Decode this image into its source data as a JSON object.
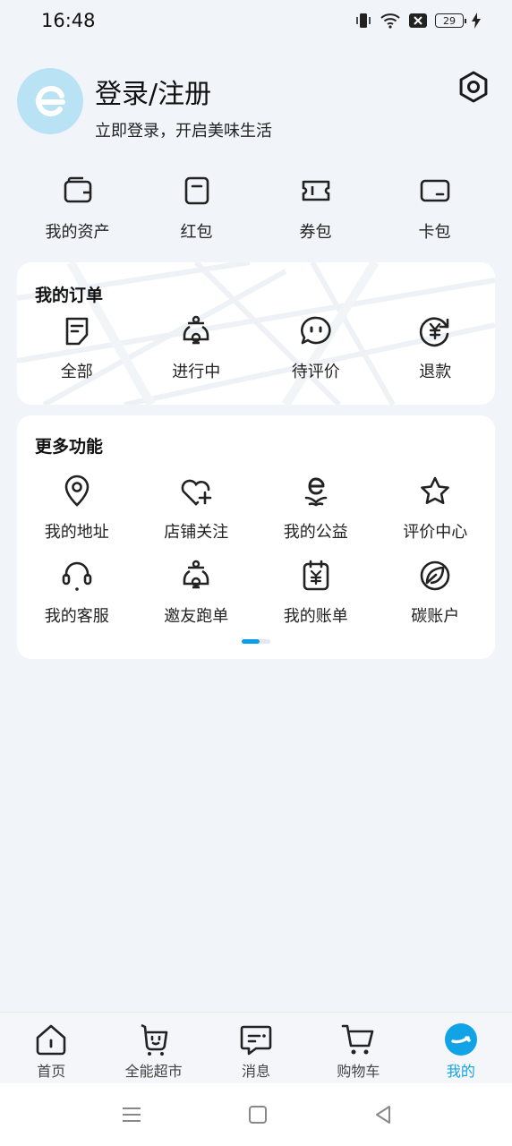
{
  "status_bar": {
    "time": "16:48",
    "battery": "29"
  },
  "header": {
    "title": "登录/注册",
    "subtitle": "立即登录，开启美味生活"
  },
  "assets": [
    {
      "label": "我的资产",
      "icon": "wallet-icon"
    },
    {
      "label": "红包",
      "icon": "red-packet-icon"
    },
    {
      "label": "券包",
      "icon": "coupon-icon"
    },
    {
      "label": "卡包",
      "icon": "card-icon"
    }
  ],
  "orders": {
    "title": "我的订单",
    "items": [
      {
        "label": "全部",
        "icon": "document-icon"
      },
      {
        "label": "进行中",
        "icon": "scooter-icon"
      },
      {
        "label": "待评价",
        "icon": "comment-icon"
      },
      {
        "label": "退款",
        "icon": "refund-icon"
      }
    ]
  },
  "more": {
    "title": "更多功能",
    "items": [
      {
        "label": "我的地址",
        "icon": "location-icon"
      },
      {
        "label": "店铺关注",
        "icon": "heart-plus-icon"
      },
      {
        "label": "我的公益",
        "icon": "charity-icon"
      },
      {
        "label": "评价中心",
        "icon": "star-icon"
      },
      {
        "label": "我的客服",
        "icon": "headset-icon"
      },
      {
        "label": "邀友跑单",
        "icon": "scooter-icon"
      },
      {
        "label": "我的账单",
        "icon": "bill-icon"
      },
      {
        "label": "碳账户",
        "icon": "leaf-icon"
      }
    ]
  },
  "tabs": [
    {
      "label": "首页",
      "icon": "home-icon"
    },
    {
      "label": "全能超市",
      "icon": "shopping-bag-icon"
    },
    {
      "label": "消息",
      "icon": "message-icon"
    },
    {
      "label": "购物车",
      "icon": "cart-icon"
    },
    {
      "label": "我的",
      "icon": "profile-icon",
      "active": true
    }
  ],
  "colors": {
    "accent": "#12a3e6",
    "background": "#f1f4f9",
    "avatar": "#b9e3f5"
  }
}
